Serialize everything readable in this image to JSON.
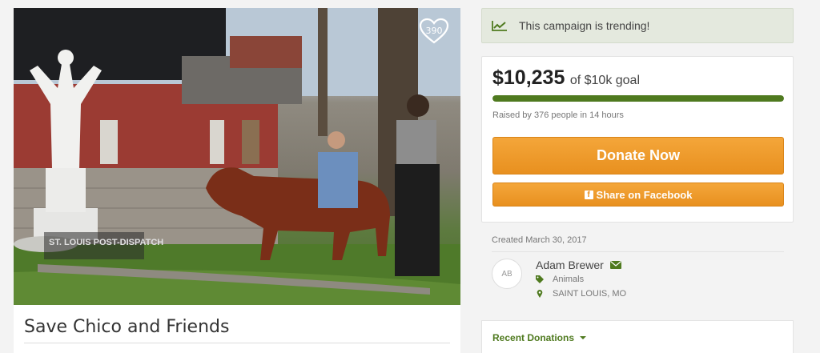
{
  "hero": {
    "watermark": "ST. LOUIS POST-DISPATCH",
    "heart_count": "390"
  },
  "campaign": {
    "title": "Save Chico and Friends"
  },
  "trending": {
    "text": "This campaign is trending!",
    "icon": "trending-chart-icon"
  },
  "donation": {
    "amount": "$10,235",
    "goal_text": "of $10k goal",
    "progress_fraction": 1.0,
    "raised_text": "Raised by 376 people in 14 hours",
    "donate_label": "Donate Now",
    "facebook_label": "Share on Facebook"
  },
  "organizer": {
    "created": "Created March 30, 2017",
    "initials": "AB",
    "name": "Adam Brewer",
    "category": "Animals",
    "location": "SAINT LOUIS, MO"
  },
  "recent": {
    "label": "Recent Donations"
  },
  "colors": {
    "accent_green": "#4f7a1f",
    "donate_orange": "#e8901f",
    "trending_bg": "#e4e9de"
  }
}
